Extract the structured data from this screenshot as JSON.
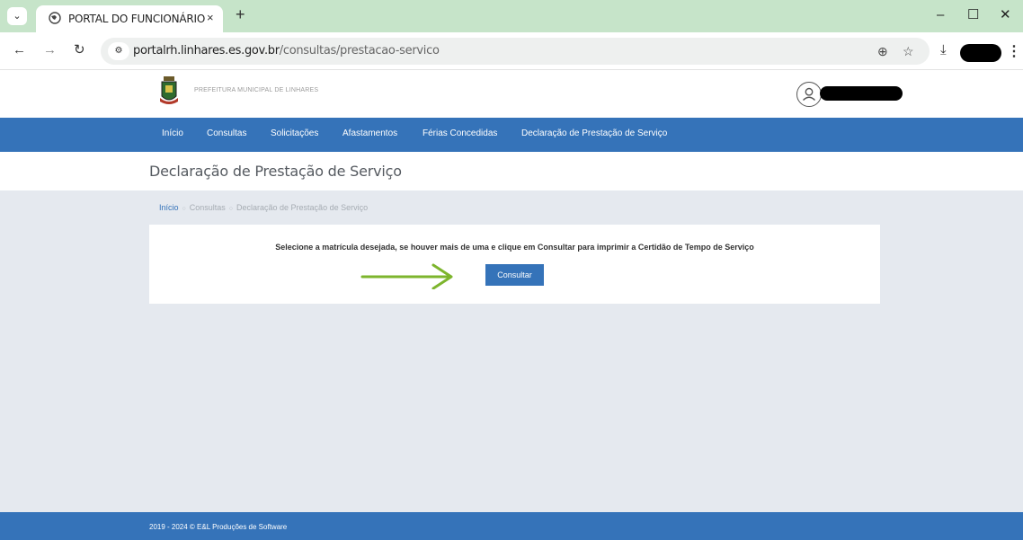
{
  "browser": {
    "tab_title": "PORTAL DO FUNCIONÁRIO",
    "tab_close": "×",
    "new_tab": "+",
    "url_host": "portalrh.linhares.es.gov.br",
    "url_path": "/consultas/prestacao-servico"
  },
  "header": {
    "brand": "PREFEITURA MUNICIPAL DE LINHARES"
  },
  "nav": {
    "items": [
      "Início",
      "Consultas",
      "Solicitações",
      "Afastamentos",
      "Férias Concedidas",
      "Declaração de Prestação de Serviço"
    ]
  },
  "page": {
    "title": "Declaração de Prestação de Serviço"
  },
  "breadcrumb": [
    "Início",
    "Consultas",
    "Declaração de Prestação de Serviço"
  ],
  "card": {
    "message": "Selecione a matrícula desejada, se houver mais de uma e clique em Consultar para imprimir a Certidão de Tempo de Serviço",
    "button_label": "Consultar"
  },
  "footer": {
    "text": "2019 - 2024 © E&L Produções de Software"
  },
  "colors": {
    "tab_strip": "#c6e4c9",
    "nav_blue": "#3573b9",
    "page_bg": "#e5e9ef",
    "arrow_green": "#7db52d"
  }
}
